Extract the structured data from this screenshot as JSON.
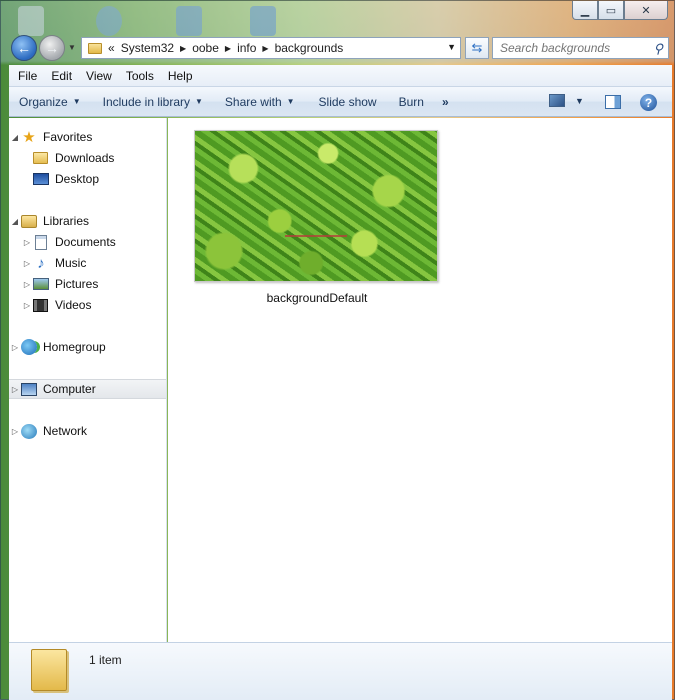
{
  "window": {
    "caption": {
      "minimize_glyph": "▁",
      "maximize_glyph": "▭",
      "close_glyph": "✕"
    }
  },
  "address": {
    "overflow": "«",
    "crumbs": [
      "System32",
      "oobe",
      "info",
      "backgrounds"
    ],
    "search_placeholder": "Search backgrounds"
  },
  "menubar": {
    "items": [
      "File",
      "Edit",
      "View",
      "Tools",
      "Help"
    ]
  },
  "toolbar": {
    "organize": "Organize",
    "include_in_library": "Include in library",
    "share_with": "Share with",
    "slide_show": "Slide show",
    "burn": "Burn",
    "more": "»",
    "help": "?"
  },
  "navpane": {
    "favorites": "Favorites",
    "downloads": "Downloads",
    "desktop": "Desktop",
    "libraries": "Libraries",
    "documents": "Documents",
    "music": "Music",
    "pictures": "Pictures",
    "videos": "Videos",
    "homegroup": "Homegroup",
    "computer": "Computer",
    "network": "Network",
    "icons": {
      "favorites": "star-icon",
      "downloads": "downloads-folder-icon",
      "desktop": "desktop-icon",
      "libraries": "libraries-icon",
      "documents": "documents-icon",
      "music": "music-icon",
      "pictures": "pictures-icon",
      "videos": "videos-icon",
      "homegroup": "homegroup-icon",
      "computer": "computer-icon",
      "network": "network-icon"
    }
  },
  "content": {
    "files": [
      {
        "name": "backgroundDefault"
      }
    ]
  },
  "details": {
    "item_count": "1 item"
  },
  "colors": {
    "accent": "#1e3a5f",
    "selection": "#e4e7eb"
  }
}
